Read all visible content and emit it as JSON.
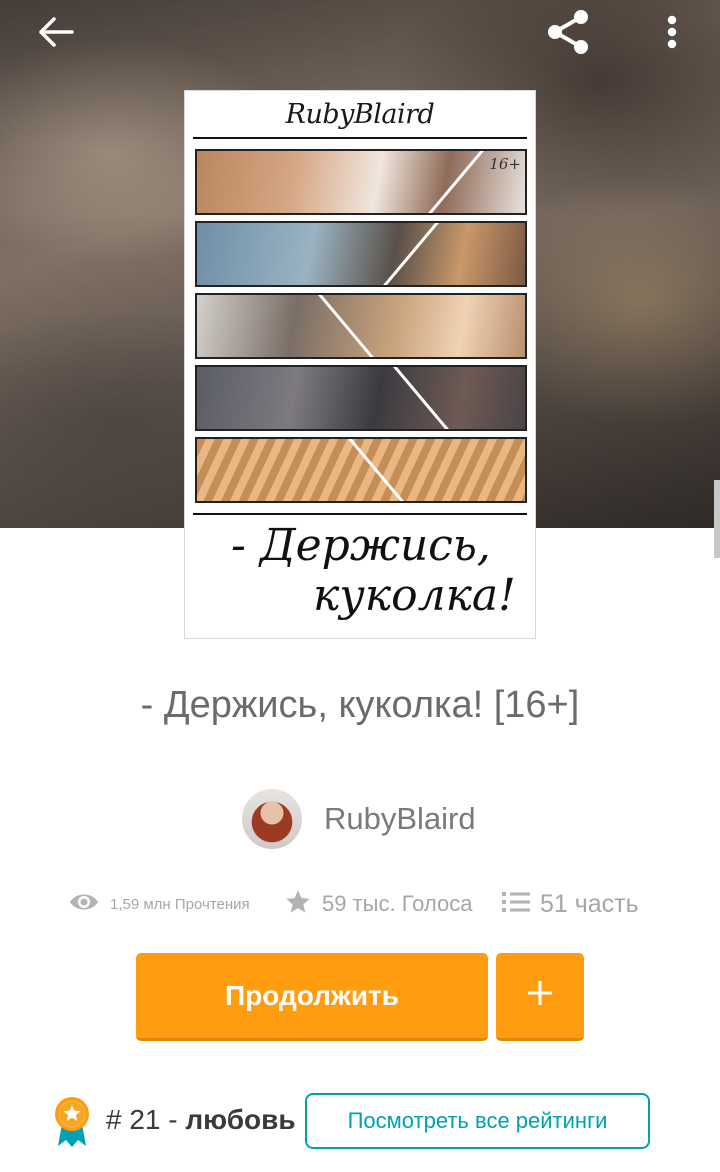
{
  "icons": {
    "back": "arrow-left-icon",
    "share": "share-icon",
    "more": "more-vertical-icon",
    "reads": "eye-icon",
    "votes": "star-icon",
    "parts": "list-icon",
    "add": "plus-icon",
    "rank": "award-ribbon-icon"
  },
  "cover": {
    "author_script": "RubyBlaird",
    "tag": "16+",
    "title_line1": "- Держись,",
    "title_line2": "куколка!"
  },
  "book": {
    "title": "- Держись, куколка! [16+]",
    "author": "RubyBlaird"
  },
  "stats": {
    "reads": "1,59 млн Прочтения",
    "votes": "59 тыс. Голоса",
    "parts": "51 часть"
  },
  "actions": {
    "continue_label": "Продолжить",
    "add_label": "+",
    "ratings_label": "Посмотреть все рейтинги"
  },
  "rank": {
    "number": "# 21",
    "separator": "-",
    "tag": "любовь"
  },
  "colors": {
    "accent_orange": "#ff9c10",
    "accent_teal": "#00a1b2",
    "muted_text": "#a6a6a6",
    "title_text": "#6b6b6b"
  }
}
